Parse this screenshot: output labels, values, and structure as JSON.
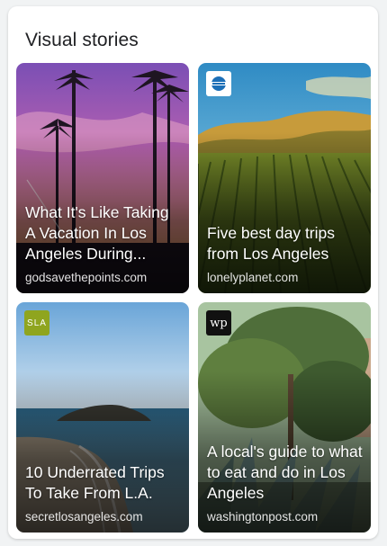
{
  "section": {
    "title": "Visual stories"
  },
  "stories": [
    {
      "headline": "What It's Like Taking A Vacation In Los Angeles During...",
      "source": "godsavethepoints.com",
      "logo": null
    },
    {
      "headline": "Five best day trips from Los Angeles",
      "source": "lonelyplanet.com",
      "logo": {
        "icon": "lonely-planet-logo",
        "text": ""
      }
    },
    {
      "headline": "10 Underrated Trips To Take From L.A.",
      "source": "secretlosangeles.com",
      "logo": {
        "icon": "secret-la-logo",
        "text": "SLA"
      }
    },
    {
      "headline": "A local's guide to what to eat and do in Los Angeles",
      "source": "washingtonpost.com",
      "logo": {
        "icon": "washington-post-logo",
        "text": "wp"
      }
    }
  ],
  "colors": {
    "panel_bg": "#ffffff",
    "page_bg": "#f1f3f4",
    "sla_green": "#8fa51f",
    "lonely_planet_blue": "#1c6fb7"
  }
}
